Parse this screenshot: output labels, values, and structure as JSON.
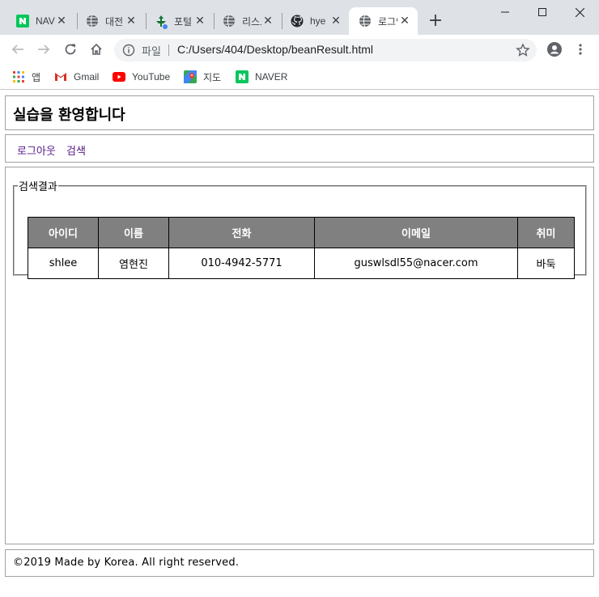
{
  "browser": {
    "tabs": [
      {
        "title": "NAVER",
        "icon": "naver-icon"
      },
      {
        "title": "대전",
        "icon": "globe-icon"
      },
      {
        "title": "포털",
        "icon": "portal-icon"
      },
      {
        "title": "리스트",
        "icon": "globe-icon"
      },
      {
        "title": "hye",
        "icon": "github-icon"
      },
      {
        "title": "로그인",
        "icon": "globe-icon",
        "active": true
      }
    ],
    "address": {
      "scheme_label": "파일",
      "url": "C:/Users/404/Desktop/beanResult.html"
    },
    "bookmarks": [
      {
        "label": "앱",
        "icon": "apps-grid-icon"
      },
      {
        "label": "Gmail",
        "icon": "gmail-icon"
      },
      {
        "label": "YouTube",
        "icon": "youtube-icon"
      },
      {
        "label": "지도",
        "icon": "maps-icon"
      },
      {
        "label": "NAVER",
        "icon": "naver-icon"
      }
    ]
  },
  "page": {
    "title": "실습을 환영합니다",
    "nav": {
      "logout": "로그아웃",
      "search": "검색"
    },
    "results": {
      "legend": "검색결과",
      "headers": [
        "아이디",
        "이름",
        "전화",
        "이메일",
        "취미"
      ],
      "rows": [
        [
          "shlee",
          "염현진",
          "010-4942-5771",
          "guswlsdl55@nacer.com",
          "바둑"
        ]
      ]
    },
    "footer": "©2019 Made by Korea. All right reserved."
  },
  "colors": {
    "table_header_bg": "#808080",
    "link_visited": "#551a8b",
    "chrome_bg": "#dee1e6"
  }
}
